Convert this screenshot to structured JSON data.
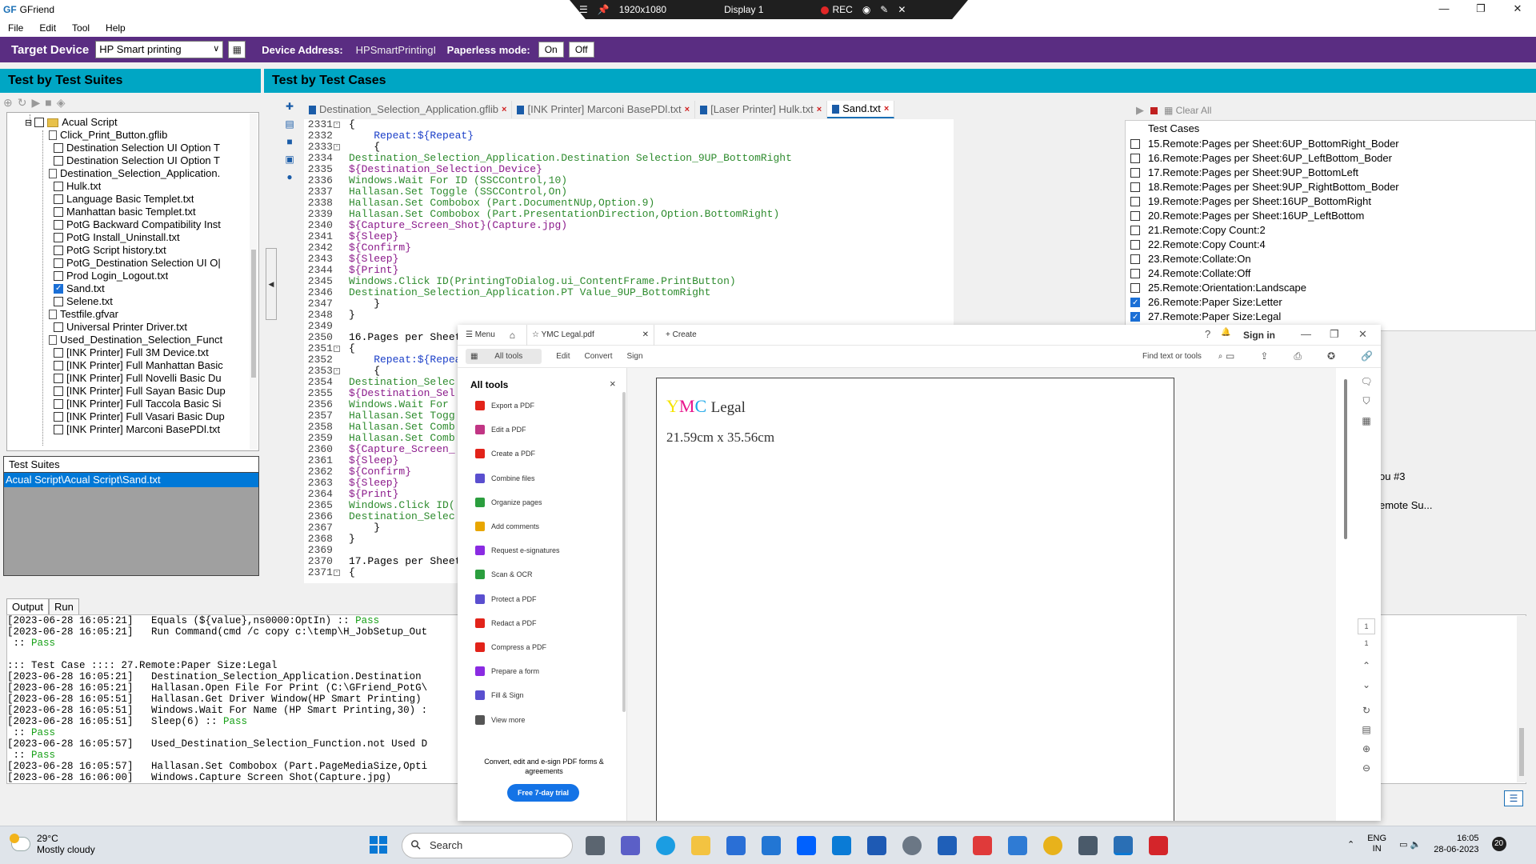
{
  "app": {
    "logo": "GF",
    "title": "GFriend"
  },
  "window_controls": {
    "minimize": "—",
    "maximize": "❐",
    "close": "✕"
  },
  "recorder": {
    "menu": "☰",
    "pin": "📌",
    "resolution": "1920x1080",
    "display": "Display 1",
    "rec": "REC",
    "camera": "◉",
    "pen": "✎",
    "close": "✕"
  },
  "menu": [
    "File",
    "Edit",
    "Tool",
    "Help"
  ],
  "device_bar": {
    "target_label": "Target Device",
    "target_value": "HP Smart printing",
    "address_label": "Device Address:",
    "address_value": "HPSmartPrintingI",
    "paperless_label": "Paperless mode:",
    "on": "On",
    "off": "Off",
    "bg_color": "#5a2d82"
  },
  "left_panel": {
    "title": "Test by Test Suites",
    "tree": [
      {
        "label": "Acual Script",
        "type": "folder",
        "checked": false
      },
      {
        "label": "Click_Print_Button.gflib",
        "type": "doc"
      },
      {
        "label": "Destination Selection UI Option T",
        "type": "check",
        "checked": false
      },
      {
        "label": "Destination Selection UI Option T",
        "type": "check",
        "checked": false
      },
      {
        "label": "Destination_Selection_Application.",
        "type": "doc"
      },
      {
        "label": "Hulk.txt",
        "type": "check",
        "checked": false
      },
      {
        "label": "Language Basic Templet.txt",
        "type": "check",
        "checked": false
      },
      {
        "label": "Manhattan basic Templet.txt",
        "type": "check",
        "checked": false
      },
      {
        "label": "PotG Backward Compatibility Inst",
        "type": "check",
        "checked": false
      },
      {
        "label": "PotG Install_Uninstall.txt",
        "type": "check",
        "checked": false
      },
      {
        "label": "PotG Script history.txt",
        "type": "check",
        "checked": false
      },
      {
        "label": "PotG_Destination Selection UI O|",
        "type": "check",
        "checked": false
      },
      {
        "label": "Prod Login_Logout.txt",
        "type": "check",
        "checked": false
      },
      {
        "label": "Sand.txt",
        "type": "check",
        "checked": true
      },
      {
        "label": "Selene.txt",
        "type": "check",
        "checked": false
      },
      {
        "label": "Testfile.gfvar",
        "type": "doc"
      },
      {
        "label": "Universal Printer Driver.txt",
        "type": "check",
        "checked": false
      },
      {
        "label": "Used_Destination_Selection_Funct",
        "type": "doc"
      },
      {
        "label": "[INK Printer] Full 3M Device.txt",
        "type": "check",
        "checked": false
      },
      {
        "label": "[INK Printer] Full Manhattan Basic",
        "type": "check",
        "checked": false
      },
      {
        "label": "[INK Printer] Full Novelli Basic Du",
        "type": "check",
        "checked": false
      },
      {
        "label": "[INK Printer] Full Sayan Basic Dup",
        "type": "check",
        "checked": false
      },
      {
        "label": "[INK Printer] Full Taccola Basic Si",
        "type": "check",
        "checked": false
      },
      {
        "label": "[INK Printer] Full Vasari Basic Dup",
        "type": "check",
        "checked": false
      },
      {
        "label": "[INK Printer] Marconi BasePDl.txt",
        "type": "check",
        "checked": false
      }
    ],
    "suites_header": "Test Suites",
    "suites_selected": "Acual Script\\Acual Script\\Sand.txt"
  },
  "right_panel": {
    "title": "Test by Test Cases"
  },
  "editor_tabs": [
    {
      "label": "Destination_Selection_Application.gflib",
      "active": false
    },
    {
      "label": "[INK Printer] Marconi BasePDl.txt",
      "active": false
    },
    {
      "label": "[Laser Printer] Hulk.txt",
      "active": false
    },
    {
      "label": "Sand.txt",
      "active": true
    }
  ],
  "tab_close": "×",
  "editor": {
    "lines": [
      {
        "n": "2331",
        "t": "{",
        "c": ""
      },
      {
        "n": "2332",
        "t": "    Repeat:${Repeat}",
        "c": "b"
      },
      {
        "n": "2333",
        "t": "    {",
        "c": ""
      },
      {
        "n": "2334",
        "t": "Destination_Selection_Application.Destination Selection_9UP_BottomRight",
        "c": "g"
      },
      {
        "n": "2335",
        "t": "${Destination_Selection_Device}",
        "c": "p"
      },
      {
        "n": "2336",
        "t": "Windows.Wait For ID (SSCControl,10)",
        "c": "g"
      },
      {
        "n": "2337",
        "t": "Hallasan.Set Toggle (SSCControl,On)",
        "c": "g"
      },
      {
        "n": "2338",
        "t": "Hallasan.Set Combobox (Part.DocumentNUp,Option.9)",
        "c": "g"
      },
      {
        "n": "2339",
        "t": "Hallasan.Set Combobox (Part.PresentationDirection,Option.BottomRight)",
        "c": "g"
      },
      {
        "n": "2340",
        "t": "${Capture_Screen_Shot}(Capture.jpg)",
        "c": "p"
      },
      {
        "n": "2341",
        "t": "${Sleep}",
        "c": "p"
      },
      {
        "n": "2342",
        "t": "${Confirm}",
        "c": "p"
      },
      {
        "n": "2343",
        "t": "${Sleep}",
        "c": "p"
      },
      {
        "n": "2344",
        "t": "${Print}",
        "c": "p"
      },
      {
        "n": "2345",
        "t": "Windows.Click ID(PrintingToDialog.ui_ContentFrame.PrintButton)",
        "c": "g"
      },
      {
        "n": "2346",
        "t": "Destination_Selection_Application.PT Value_9UP_BottomRight",
        "c": "g"
      },
      {
        "n": "2347",
        "t": "    }",
        "c": ""
      },
      {
        "n": "2348",
        "t": "}",
        "c": ""
      },
      {
        "n": "2349",
        "t": "",
        "c": ""
      },
      {
        "n": "2350",
        "t": "16.Pages per Sheet",
        "c": ""
      },
      {
        "n": "2351",
        "t": "{",
        "c": ""
      },
      {
        "n": "2352",
        "t": "    Repeat:${Repea",
        "c": "b"
      },
      {
        "n": "2353",
        "t": "    {",
        "c": ""
      },
      {
        "n": "2354",
        "t": "Destination_Selec",
        "c": "g"
      },
      {
        "n": "2355",
        "t": "${Destination_Sel",
        "c": "p"
      },
      {
        "n": "2356",
        "t": "Windows.Wait For",
        "c": "g"
      },
      {
        "n": "2357",
        "t": "Hallasan.Set Togg",
        "c": "g"
      },
      {
        "n": "2358",
        "t": "Hallasan.Set Comb",
        "c": "g"
      },
      {
        "n": "2359",
        "t": "Hallasan.Set Comb",
        "c": "g"
      },
      {
        "n": "2360",
        "t": "${Capture_Screen_",
        "c": "p"
      },
      {
        "n": "2361",
        "t": "${Sleep}",
        "c": "p"
      },
      {
        "n": "2362",
        "t": "${Confirm}",
        "c": "p"
      },
      {
        "n": "2363",
        "t": "${Sleep}",
        "c": "p"
      },
      {
        "n": "2364",
        "t": "${Print}",
        "c": "p"
      },
      {
        "n": "2365",
        "t": "Windows.Click ID(",
        "c": "g"
      },
      {
        "n": "2366",
        "t": "Destination_Selec",
        "c": "g"
      },
      {
        "n": "2367",
        "t": "    }",
        "c": ""
      },
      {
        "n": "2368",
        "t": "}",
        "c": ""
      },
      {
        "n": "2369",
        "t": "",
        "c": ""
      },
      {
        "n": "2370",
        "t": "17.Pages per Sheet",
        "c": ""
      },
      {
        "n": "2371",
        "t": "{",
        "c": ""
      }
    ]
  },
  "test_cases": {
    "clear_all": "Clear All",
    "header": "Test Cases",
    "items": [
      {
        "label": "15.Remote:Pages per Sheet:6UP_BottomRight_Boder",
        "checked": false
      },
      {
        "label": "16.Remote:Pages per Sheet:6UP_LeftBottom_Boder",
        "checked": false
      },
      {
        "label": "17.Remote:Pages per Sheet:9UP_BottomLeft",
        "checked": false
      },
      {
        "label": "18.Remote:Pages per Sheet:9UP_RightBottom_Boder",
        "checked": false
      },
      {
        "label": "19.Remote:Pages per Sheet:16UP_BottomRight",
        "checked": false
      },
      {
        "label": "20.Remote:Pages per Sheet:16UP_LeftBottom",
        "checked": false
      },
      {
        "label": "21.Remote:Copy Count:2",
        "checked": false
      },
      {
        "label": "22.Remote:Copy Count:4",
        "checked": false
      },
      {
        "label": "23.Remote:Collate:On",
        "checked": false
      },
      {
        "label": "24.Remote:Collate:Off",
        "checked": false
      },
      {
        "label": "25.Remote:Orientation:Landscape",
        "checked": false
      },
      {
        "label": "26.Remote:Paper Size:Letter",
        "checked": true
      },
      {
        "label": "27.Remote:Paper Size:Legal",
        "checked": true
      }
    ],
    "partial1": "ou #3",
    "partial2": "emote Su..."
  },
  "output": {
    "tabs": [
      "Output",
      "Run"
    ],
    "lines": [
      {
        "t": "[2023-06-28 16:05:21]   Equals (${value},ns0000:OptIn) :: ",
        "p": "Pass"
      },
      {
        "t": "[2023-06-28 16:05:21]   Run Command(cmd /c copy c:\\temp\\H_JobSetup_Out",
        "p": ""
      },
      {
        "t": " :: ",
        "p": "Pass"
      },
      {
        "t": "",
        "p": ""
      },
      {
        "t": "::: Test Case :::: 27.Remote:Paper Size:Legal",
        "p": ""
      },
      {
        "t": "[2023-06-28 16:05:21]   Destination_Selection_Application.Destination",
        "p": ""
      },
      {
        "t": "[2023-06-28 16:05:21]   Hallasan.Open File For Print (C:\\GFriend_PotG\\",
        "p": ""
      },
      {
        "t": "[2023-06-28 16:05:51]   Hallasan.Get Driver Window(HP Smart Printing)",
        "p": ""
      },
      {
        "t": "[2023-06-28 16:05:51]   Windows.Wait For Name (HP Smart Printing,30) :",
        "p": ""
      },
      {
        "t": "[2023-06-28 16:05:51]   Sleep(6) :: ",
        "p": "Pass"
      },
      {
        "t": " :: ",
        "p": "Pass"
      },
      {
        "t": "[2023-06-28 16:05:57]   Used_Destination_Selection_Function.not Used D",
        "p": ""
      },
      {
        "t": " :: ",
        "p": "Pass"
      },
      {
        "t": "[2023-06-28 16:05:57]   Hallasan.Set Combobox (Part.PageMediaSize,Opti",
        "p": ""
      },
      {
        "t": "[2023-06-28 16:06:00]   Windows.Capture Screen Shot(Capture.jpg)",
        "p": ""
      }
    ]
  },
  "pdf": {
    "menu": "☰  Menu",
    "home": "⌂",
    "tab_title": "☆  YMC Legal.pdf",
    "tab_close": "✕",
    "create": "+ Create",
    "help": "?",
    "bell": "🔔",
    "signin": "Sign in",
    "toolbar": [
      "All tools",
      "Edit",
      "Convert",
      "Sign"
    ],
    "find": "Find text or tools",
    "tools_title": "All tools",
    "tools_close": "×",
    "tools": [
      {
        "label": "Export a PDF",
        "color": "#e2231a"
      },
      {
        "label": "Edit a PDF",
        "color": "#c13584"
      },
      {
        "label": "Create a PDF",
        "color": "#e2231a"
      },
      {
        "label": "Combine files",
        "color": "#5a4fcf"
      },
      {
        "label": "Organize pages",
        "color": "#2b9e3e"
      },
      {
        "label": "Add comments",
        "color": "#e8a600"
      },
      {
        "label": "Request e-signatures",
        "color": "#8a2be2"
      },
      {
        "label": "Scan & OCR",
        "color": "#2b9e3e"
      },
      {
        "label": "Protect a PDF",
        "color": "#5a4fcf"
      },
      {
        "label": "Redact a PDF",
        "color": "#e2231a"
      },
      {
        "label": "Compress a PDF",
        "color": "#e2231a"
      },
      {
        "label": "Prepare a form",
        "color": "#8a2be2"
      },
      {
        "label": "Fill & Sign",
        "color": "#5a4fcf"
      },
      {
        "label": "View more",
        "color": "#555555"
      }
    ],
    "promo": "Convert, edit and e-sign PDF forms & agreements",
    "trial": "Free 7-day trial",
    "doc_y": "Y",
    "doc_m": "M",
    "doc_c": "C",
    "doc_legal": "Legal",
    "doc_size": "21.59cm x 35.56cm",
    "page_num": "1",
    "page_total": "1"
  },
  "taskbar": {
    "temp": "29°C",
    "weather": "Mostly cloudy",
    "search": "Search",
    "lang1": "ENG",
    "lang2": "IN",
    "time": "16:05",
    "date": "28-06-2023",
    "notif": "20"
  }
}
